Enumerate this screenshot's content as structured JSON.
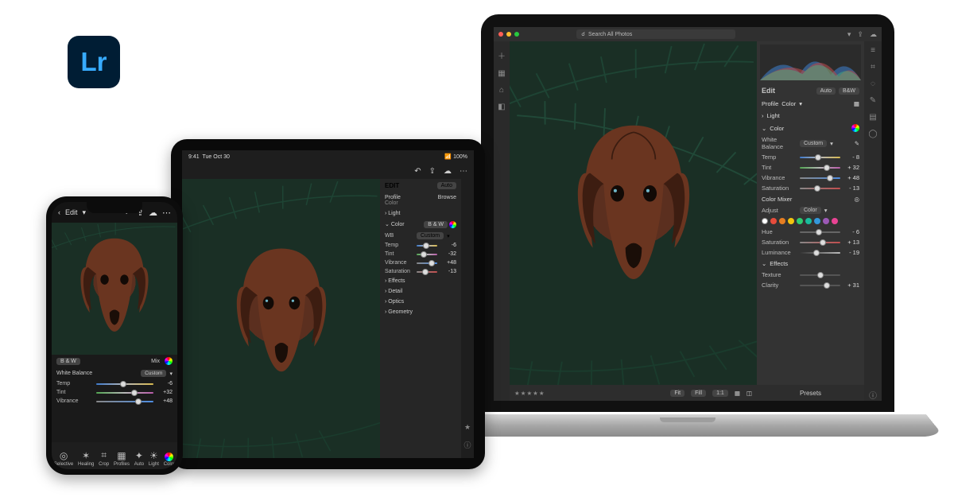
{
  "app": {
    "shortName": "Lr"
  },
  "laptop": {
    "searchPlaceholder": "Search All Photos",
    "edit": {
      "title": "Edit",
      "auto": "Auto",
      "bw": "B&W"
    },
    "profile": {
      "label": "Profile",
      "browse": "Color"
    },
    "sections": {
      "light": "Light",
      "color": "Color",
      "colorMixer": "Color Mixer",
      "effects": "Effects"
    },
    "wb": {
      "label": "White Balance",
      "value": "Custom"
    },
    "sliders": {
      "temp": {
        "label": "Temp",
        "value": "- 8",
        "pct": 46
      },
      "tint": {
        "label": "Tint",
        "value": "+ 32",
        "pct": 66
      },
      "vibrance": {
        "label": "Vibrance",
        "value": "+ 48",
        "pct": 74
      },
      "saturation": {
        "label": "Saturation",
        "value": "- 13",
        "pct": 44
      }
    },
    "mixer": {
      "adjust": {
        "label": "Adjust",
        "value": "Color"
      },
      "hue": {
        "label": "Hue",
        "value": "- 6",
        "pct": 47
      },
      "msat": {
        "label": "Saturation",
        "value": "+ 13",
        "pct": 57
      },
      "luminance": {
        "label": "Luminance",
        "value": "- 19",
        "pct": 41
      }
    },
    "effects": {
      "texture": {
        "label": "Texture",
        "value": "",
        "pct": 50
      },
      "clarity": {
        "label": "Clarity",
        "value": "+ 31",
        "pct": 66
      }
    },
    "bottom": {
      "fit": "Fit",
      "fill": "Fill",
      "oneone": "1:1"
    },
    "presets": "Presets"
  },
  "tablet": {
    "status": {
      "time": "9:41",
      "date": "Tue Oct 30",
      "batt": "100%"
    },
    "edit": {
      "title": "EDIT",
      "auto": "Auto"
    },
    "profile": {
      "label": "Profile",
      "browse": "Browse",
      "sub": "Color"
    },
    "sections": {
      "light": "Light",
      "color": "Color",
      "effects": "Effects",
      "detail": "Detail",
      "optics": "Optics",
      "geometry": "Geometry"
    },
    "colorRow": {
      "bw": "B & W"
    },
    "wb": {
      "label": "WB",
      "value": "Custom"
    },
    "sliders": {
      "temp": {
        "label": "Temp",
        "value": "-6",
        "pct": 47
      },
      "tint": {
        "label": "Tint",
        "value": "-32",
        "pct": 34
      },
      "vibrance": {
        "label": "Vibrance",
        "value": "+48",
        "pct": 74
      },
      "saturation": {
        "label": "Saturation",
        "value": "-13",
        "pct": 44
      }
    }
  },
  "phone": {
    "top": {
      "back": "‹",
      "title": "Edit"
    },
    "bwRow": {
      "bw": "B & W",
      "mix": "Mix"
    },
    "wb": {
      "label": "White Balance",
      "value": "Custom"
    },
    "sliders": {
      "temp": {
        "label": "Temp",
        "value": "-6",
        "pct": 47
      },
      "tint": {
        "label": "Tint",
        "value": "+32",
        "pct": 66
      },
      "vibrance": {
        "label": "Vibrance",
        "value": "+48",
        "pct": 74
      }
    },
    "tools": [
      {
        "name": "Selective"
      },
      {
        "name": "Healing"
      },
      {
        "name": "Crop"
      },
      {
        "name": "Profiles"
      },
      {
        "name": "Auto"
      },
      {
        "name": "Light"
      },
      {
        "name": "Color"
      }
    ]
  }
}
